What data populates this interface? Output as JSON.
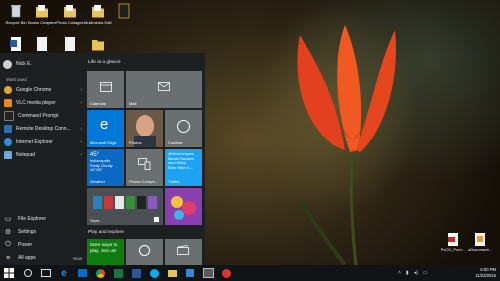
{
  "desktop": {
    "icons_left": [
      {
        "label": "Recycle Bin",
        "icon": "recycle-bin-icon"
      },
      {
        "label": "Books Chapters",
        "icon": "folder-icon"
      },
      {
        "label": "Photo Collages",
        "icon": "folder-icon"
      },
      {
        "label": "Multimedia Edits",
        "icon": "folder-icon"
      },
      {
        "label": "",
        "icon": "folder-icon"
      }
    ],
    "icons_right": [
      {
        "label": "PvCD_Porn...",
        "icon": "pdf-file-icon"
      },
      {
        "label": "aDocument...",
        "icon": "document-icon"
      }
    ]
  },
  "start_menu": {
    "user_name": "Nick E.",
    "most_used_label": "Most used",
    "apps": [
      {
        "label": "Google Chrome",
        "color": "#e8a33a",
        "has_submenu": true
      },
      {
        "label": "VLC media player",
        "color": "#f08a00",
        "has_submenu": true
      },
      {
        "label": "Command Prompt",
        "color": "#222222",
        "has_submenu": false
      },
      {
        "label": "Remote Desktop Conn...",
        "color": "#2b6fb5",
        "has_submenu": true
      },
      {
        "label": "Internet Explorer",
        "color": "#2e8fdc",
        "has_submenu": true
      },
      {
        "label": "Notepad",
        "color": "#6fa8d6",
        "has_submenu": true
      }
    ],
    "system": [
      {
        "label": "File Explorer",
        "glyph": "▭"
      },
      {
        "label": "Settings",
        "glyph": "⚙"
      },
      {
        "label": "Power",
        "glyph": "⏻"
      },
      {
        "label": "All apps",
        "glyph": "≡",
        "extra": "New"
      }
    ],
    "group1_title": "Life at a glance",
    "group2_title": "Play and explore",
    "tiles": {
      "calendar": "Calendar",
      "mail": "Mail",
      "edge": "Microsoft Edge",
      "photos": "Photos",
      "cortana": "Cortana",
      "weather_temp": "45°",
      "weather_lines": [
        "Indianapolis",
        "Partly Cloudy",
        "44°/39°"
      ],
      "weather": "Weather",
      "phone": "Phone Compa...",
      "twitter_lines": [
        "@rfevershanes",
        "Bernie Sanders",
        "and Hillary",
        "Killer Mike in..."
      ],
      "twitter": "Twitter",
      "store": "Store",
      "candy": "",
      "xbox_text": "More ways to play. Join us!",
      "groove": "",
      "movies": ""
    }
  },
  "taskbar": {
    "clock_time": "6:00 PM",
    "clock_date": "11/23/2015"
  },
  "colors": {
    "accent": "#0078d7",
    "tile_gray": "#6a6f71",
    "start_bg": "#1c2022",
    "taskbar_bg": "#111416",
    "xbox_green": "#107c10",
    "twitter_blue": "#1da1f2"
  }
}
